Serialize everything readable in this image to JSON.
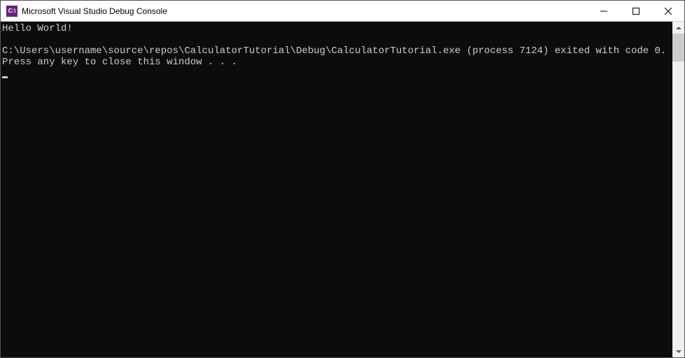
{
  "window": {
    "title": "Microsoft Visual Studio Debug Console",
    "icon_text": "C:\\"
  },
  "console": {
    "lines": [
      "Hello World!",
      "",
      "C:\\Users\\username\\source\\repos\\CalculatorTutorial\\Debug\\CalculatorTutorial.exe (process 7124) exited with code 0.",
      "Press any key to close this window . . ."
    ]
  }
}
